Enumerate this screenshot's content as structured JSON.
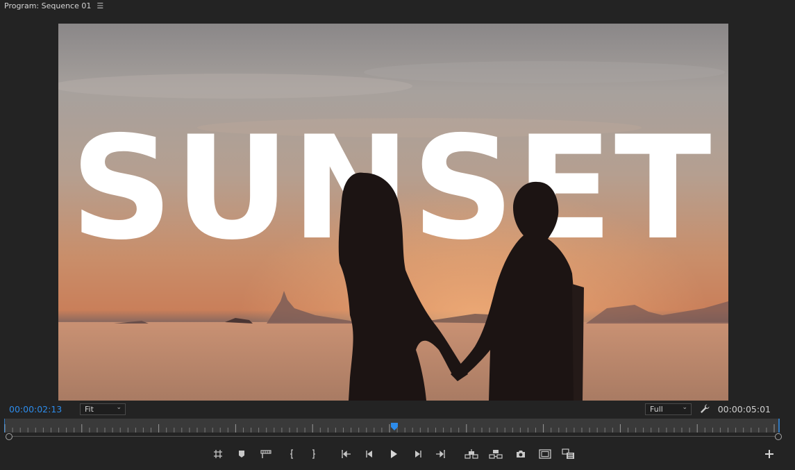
{
  "panel": {
    "title": "Program: Sequence 01",
    "menu_icon": "hamburger-menu-icon"
  },
  "frame": {
    "title_text": "SUNSET",
    "scene": "silhouettes of two people holding hands on a beach at sunset"
  },
  "timecode": {
    "current": "00:00:02:13",
    "duration": "00:00:05:01"
  },
  "zoom": {
    "selected": "Fit"
  },
  "resolution": {
    "selected": "Full"
  },
  "playhead": {
    "position_fraction": 0.503
  },
  "transport": {
    "buttons": [
      "add-marker-icon",
      "marker-icon",
      "clip-marker-icon",
      "mark-in-icon",
      "mark-out-icon",
      "go-to-in-icon",
      "step-back-icon",
      "play-icon",
      "step-forward-icon",
      "go-to-out-icon",
      "lift-icon",
      "extract-icon",
      "export-frame-icon",
      "safe-margins-icon",
      "compare-view-icon"
    ],
    "add_icon": "plus-icon"
  },
  "colors": {
    "accent": "#2d8ceb",
    "background": "#232323",
    "ruler": "#3a3a3a"
  }
}
